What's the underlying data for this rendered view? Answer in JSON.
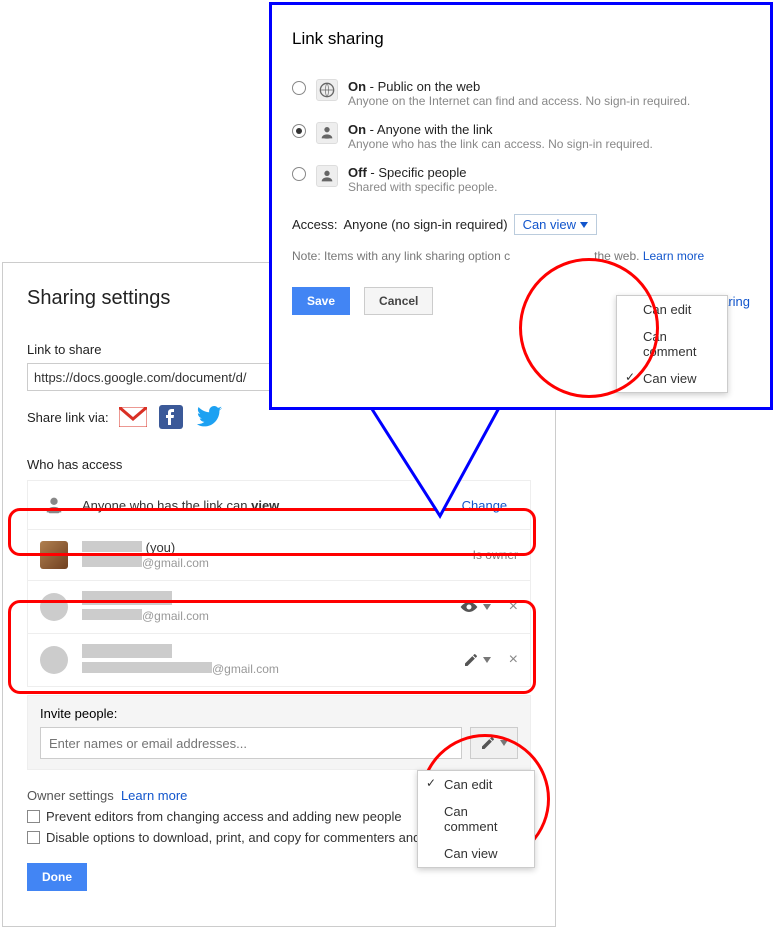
{
  "shareSettings": {
    "title": "Sharing settings",
    "linkToShareLabel": "Link to share",
    "linkValue": "https://docs.google.com/document/d/",
    "shareViaLabel": "Share link via:",
    "whoHasAccessLabel": "Who has access",
    "linkAccess": {
      "prefix": "Anyone who has the link can ",
      "perm": "view",
      "changeLabel": "Change..."
    },
    "users": [
      {
        "nameSuffix": "(you)",
        "email": "@gmail.com",
        "role": "Is owner",
        "icon": "avatar"
      },
      {
        "email": "@gmail.com",
        "perm": "view"
      },
      {
        "email": "@gmail.com",
        "perm": "edit"
      }
    ],
    "invite": {
      "title": "Invite people:",
      "placeholder": "Enter names or email addresses..."
    },
    "inviteMenu": {
      "items": [
        "Can edit",
        "Can comment",
        "Can view"
      ],
      "selectedIndex": 0
    },
    "owner": {
      "label": "Owner settings",
      "learnMore": "Learn more",
      "chk1": "Prevent editors from changing access and adding new people",
      "chk2": "Disable options to download, print, and copy for commenters and viewers"
    },
    "doneLabel": "Done"
  },
  "linkSharing": {
    "title": "Link sharing",
    "options": [
      {
        "titleStrong": "On",
        "titleRest": " - Public on the web",
        "sub": "Anyone on the Internet can find and access. No sign-in required."
      },
      {
        "titleStrong": "On",
        "titleRest": " - Anyone with the link",
        "sub": "Anyone who has the link can access. No sign-in required."
      },
      {
        "titleStrong": "Off",
        "titleRest": " - Specific people",
        "sub": "Shared with specific people."
      }
    ],
    "selectedIndex": 1,
    "accessLabel": "Access:",
    "accessWho": "Anyone (no sign-in required)",
    "accessPermLabel": "Can view",
    "permMenu": {
      "items": [
        "Can edit",
        "Can comment",
        "Can view"
      ],
      "selectedIndex": 2
    },
    "notePrefix": "Note: Items with any link sharing option c",
    "noteSuffixHidden": "the web.",
    "noteLearnMore": "Learn more",
    "saveLabel": "Save",
    "cancelLabel": "Cancel",
    "learnMoreLink": "about link sharing"
  }
}
